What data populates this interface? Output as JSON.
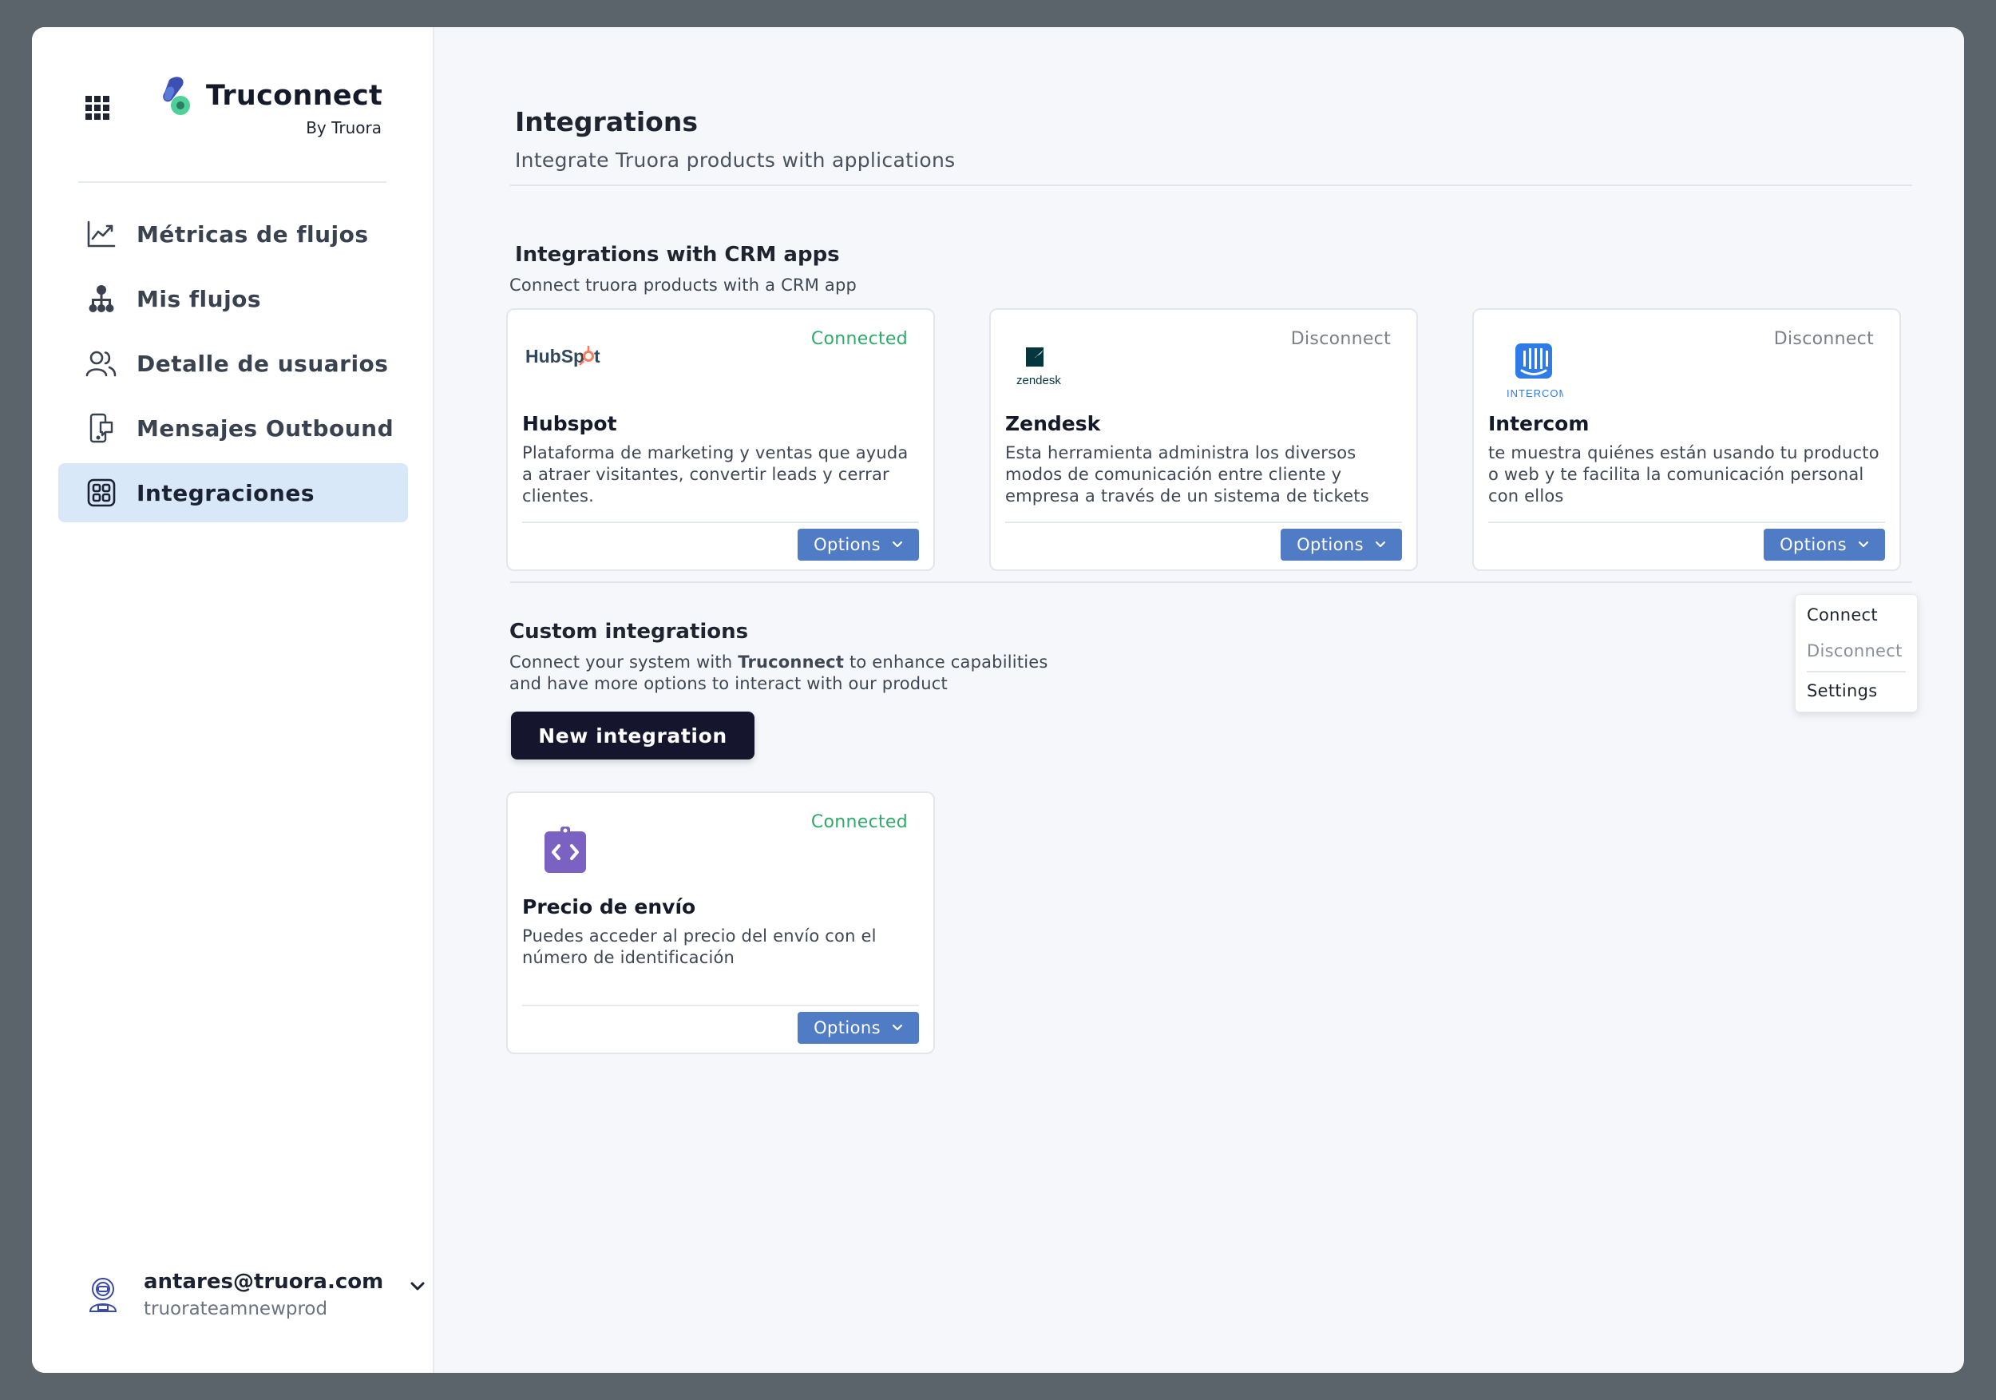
{
  "brand": {
    "name": "Truconnect",
    "byline": "By Truora",
    "colors": {
      "accent": "#4f7cc5",
      "sidebar_active": "#d9e8f8",
      "connected": "#2eab6a",
      "dark_button": "#15162e"
    }
  },
  "sidebar": {
    "items": [
      {
        "label": "Métricas de flujos",
        "icon": "chart-icon",
        "active": false
      },
      {
        "label": "Mis flujos",
        "icon": "flow-icon",
        "active": false
      },
      {
        "label": "Detalle de usuarios",
        "icon": "users-icon",
        "active": false
      },
      {
        "label": "Mensajes Outbound",
        "icon": "outbound-message-icon",
        "active": false
      },
      {
        "label": "Integraciones",
        "icon": "integrations-icon",
        "active": true
      }
    ]
  },
  "user": {
    "email": "antares@truora.com",
    "team": "truorateamnewprod"
  },
  "page": {
    "title": "Integrations",
    "subtitle": "Integrate Truora products with applications"
  },
  "crm": {
    "title": "Integrations with CRM apps",
    "subtitle": "Connect truora products with a CRM app",
    "cards": [
      {
        "name": "Hubspot",
        "logo_text": "HubSpot",
        "status": "Connected",
        "description": "Plataforma de marketing y ventas que ayuda a atraer visitantes, convertir leads y cerrar clientes.",
        "options_label": "Options"
      },
      {
        "name": "Zendesk",
        "logo_text": "zendesk",
        "status": "Disconnect",
        "description": "Esta herramienta administra los diversos modos de comunicación entre cliente y empresa a través de un sistema de tickets",
        "options_label": "Options"
      },
      {
        "name": "Intercom",
        "logo_text": "INTERCOM",
        "status": "Disconnect",
        "description": "te muestra quiénes están usando tu producto o web y te facilita la comunicación personal con ellos",
        "options_label": "Options"
      }
    ]
  },
  "dropdown": {
    "items": [
      "Connect",
      "Disconnect",
      "Settings"
    ]
  },
  "custom": {
    "title": "Custom integrations",
    "subtitle_pre": "Connect your system with ",
    "subtitle_bold": "Truconnect",
    "subtitle_post": " to enhance capabilities",
    "subtitle_line2": "and have more options to interact with our product",
    "new_button": "New integration",
    "cards": [
      {
        "name": "Precio de envío",
        "status": "Connected",
        "description": "Puedes acceder al precio del envío con el número de identificación",
        "options_label": "Options"
      }
    ]
  }
}
